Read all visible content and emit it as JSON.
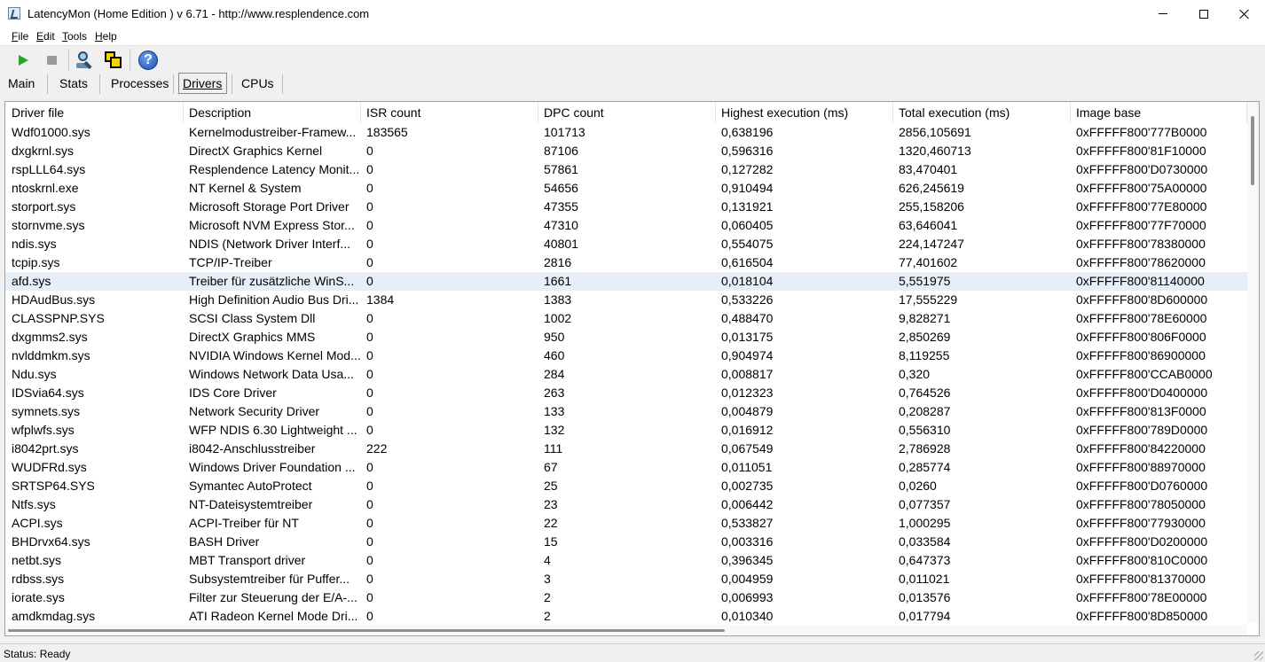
{
  "window": {
    "title": "LatencyMon  (Home Edition )  v 6.71 - http://www.resplendence.com"
  },
  "menu": [
    "File",
    "Edit",
    "Tools",
    "Help"
  ],
  "toolbar": {
    "icons": [
      "play-icon",
      "stop-icon",
      "search-drivers-icon",
      "windows-icon",
      "help-icon"
    ]
  },
  "tabs": [
    {
      "label": "Main",
      "active": false
    },
    {
      "label": "Stats",
      "active": false
    },
    {
      "label": "Processes",
      "active": false
    },
    {
      "label": "Drivers",
      "active": true
    },
    {
      "label": "CPUs",
      "active": false
    }
  ],
  "table": {
    "columns": [
      "Driver file",
      "Description",
      "ISR count",
      "DPC count",
      "Highest execution (ms)",
      "Total execution (ms)",
      "Image base"
    ],
    "selected_row": 8,
    "rows": [
      [
        "Wdf01000.sys",
        "Kernelmodustreiber-Framew...",
        "183565",
        "101713",
        "0,638196",
        "2856,105691",
        "0xFFFFF800'777B0000"
      ],
      [
        "dxgkrnl.sys",
        "DirectX Graphics Kernel",
        "0",
        "87106",
        "0,596316",
        "1320,460713",
        "0xFFFFF800'81F10000"
      ],
      [
        "rspLLL64.sys",
        "Resplendence Latency Monit...",
        "0",
        "57861",
        "0,127282",
        "83,470401",
        "0xFFFFF800'D0730000"
      ],
      [
        "ntoskrnl.exe",
        "NT Kernel & System",
        "0",
        "54656",
        "0,910494",
        "626,245619",
        "0xFFFFF800'75A00000"
      ],
      [
        "storport.sys",
        "Microsoft Storage Port Driver",
        "0",
        "47355",
        "0,131921",
        "255,158206",
        "0xFFFFF800'77E80000"
      ],
      [
        "stornvme.sys",
        "Microsoft NVM Express Stor...",
        "0",
        "47310",
        "0,060405",
        "63,646041",
        "0xFFFFF800'77F70000"
      ],
      [
        "ndis.sys",
        "NDIS (Network Driver Interf...",
        "0",
        "40801",
        "0,554075",
        "224,147247",
        "0xFFFFF800'78380000"
      ],
      [
        "tcpip.sys",
        "TCP/IP-Treiber",
        "0",
        "2816",
        "0,616504",
        "77,401602",
        "0xFFFFF800'78620000"
      ],
      [
        "afd.sys",
        "Treiber für zusätzliche WinS...",
        "0",
        "1661",
        "0,018104",
        "5,551975",
        "0xFFFFF800'81140000"
      ],
      [
        "HDAudBus.sys",
        "High Definition Audio Bus Dri...",
        "1384",
        "1383",
        "0,533226",
        "17,555229",
        "0xFFFFF800'8D600000"
      ],
      [
        "CLASSPNP.SYS",
        "SCSI Class System Dll",
        "0",
        "1002",
        "0,488470",
        "9,828271",
        "0xFFFFF800'78E60000"
      ],
      [
        "dxgmms2.sys",
        "DirectX Graphics MMS",
        "0",
        "950",
        "0,013175",
        "2,850269",
        "0xFFFFF800'806F0000"
      ],
      [
        "nvlddmkm.sys",
        "NVIDIA Windows Kernel Mod...",
        "0",
        "460",
        "0,904974",
        "8,119255",
        "0xFFFFF800'86900000"
      ],
      [
        "Ndu.sys",
        "Windows Network Data Usa...",
        "0",
        "284",
        "0,008817",
        "0,320",
        "0xFFFFF800'CCAB0000"
      ],
      [
        "IDSvia64.sys",
        "IDS Core Driver",
        "0",
        "263",
        "0,012323",
        "0,764526",
        "0xFFFFF800'D0400000"
      ],
      [
        "symnets.sys",
        "Network Security Driver",
        "0",
        "133",
        "0,004879",
        "0,208287",
        "0xFFFFF800'813F0000"
      ],
      [
        "wfplwfs.sys",
        "WFP NDIS 6.30 Lightweight ...",
        "0",
        "132",
        "0,016912",
        "0,556310",
        "0xFFFFF800'789D0000"
      ],
      [
        "i8042prt.sys",
        "i8042-Anschlusstreiber",
        "222",
        "111",
        "0,067549",
        "2,786928",
        "0xFFFFF800'84220000"
      ],
      [
        "WUDFRd.sys",
        "Windows Driver Foundation ...",
        "0",
        "67",
        "0,011051",
        "0,285774",
        "0xFFFFF800'88970000"
      ],
      [
        "SRTSP64.SYS",
        "Symantec AutoProtect",
        "0",
        "25",
        "0,002735",
        "0,0260",
        "0xFFFFF800'D0760000"
      ],
      [
        "Ntfs.sys",
        "NT-Dateisystemtreiber",
        "0",
        "23",
        "0,006442",
        "0,077357",
        "0xFFFFF800'78050000"
      ],
      [
        "ACPI.sys",
        "ACPI-Treiber für NT",
        "0",
        "22",
        "0,533827",
        "1,000295",
        "0xFFFFF800'77930000"
      ],
      [
        "BHDrvx64.sys",
        "BASH Driver",
        "0",
        "15",
        "0,003316",
        "0,033584",
        "0xFFFFF800'D0200000"
      ],
      [
        "netbt.sys",
        "MBT Transport driver",
        "0",
        "4",
        "0,396345",
        "0,647373",
        "0xFFFFF800'810C0000"
      ],
      [
        "rdbss.sys",
        "Subsystemtreiber für Puffer...",
        "0",
        "3",
        "0,004959",
        "0,011021",
        "0xFFFFF800'81370000"
      ],
      [
        "iorate.sys",
        "Filter zur Steuerung der E/A-...",
        "0",
        "2",
        "0,006993",
        "0,013576",
        "0xFFFFF800'78E00000"
      ],
      [
        "amdkmdag.sys",
        "ATI Radeon Kernel Mode Dri...",
        "0",
        "2",
        "0,010340",
        "0,017794",
        "0xFFFFF800'8D850000"
      ]
    ]
  },
  "status": {
    "text": "Status: Ready"
  }
}
